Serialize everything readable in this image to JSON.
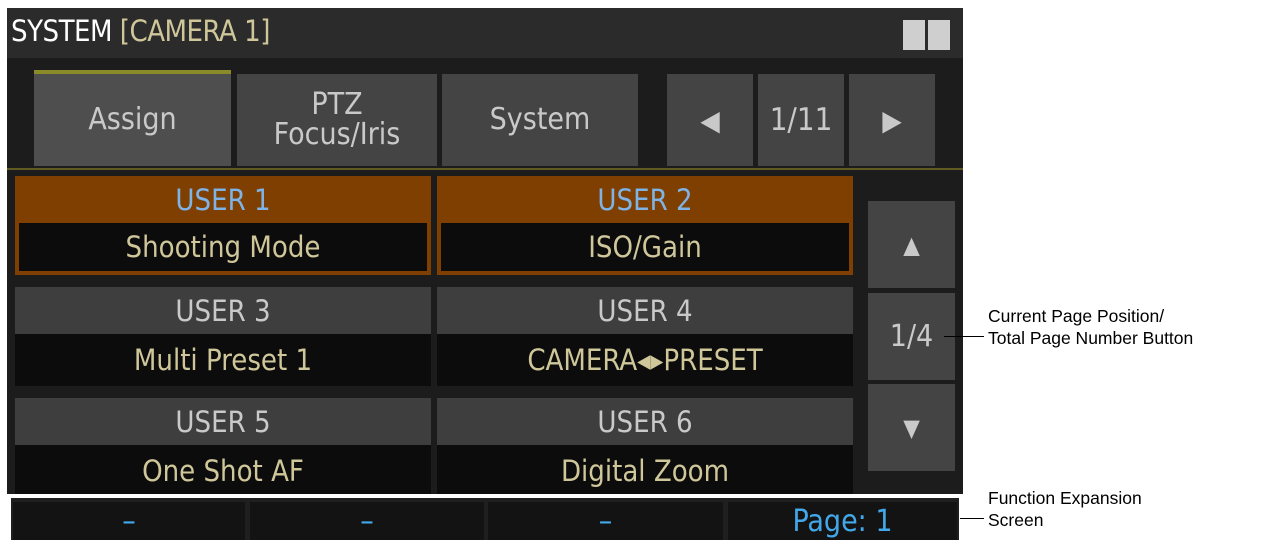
{
  "header": {
    "title_main": "SYSTEM",
    "title_camera": "[CAMERA 1]"
  },
  "tabs": [
    {
      "label": "Assign",
      "active": true
    },
    {
      "label": "PTZ\nFocus/Iris",
      "active": false
    },
    {
      "label": "System",
      "active": false
    }
  ],
  "pager": {
    "prev_icon": "left-triangle-icon",
    "prev_glyph": "◀",
    "label": "1/11",
    "next_icon": "right-triangle-icon",
    "next_glyph": "▶"
  },
  "user_slots": [
    {
      "name": "USER 1",
      "value": "Shooting Mode",
      "selected": true
    },
    {
      "name": "USER 2",
      "value": "ISO/Gain",
      "selected": true
    },
    {
      "name": "USER 3",
      "value": "Multi Preset 1",
      "selected": false
    },
    {
      "name": "USER 4",
      "value": "CAMERA◂▸PRESET",
      "selected": false
    },
    {
      "name": "USER 5",
      "value": "One Shot AF",
      "selected": false
    },
    {
      "name": "USER 6",
      "value": "Digital Zoom",
      "selected": false
    }
  ],
  "scroll": {
    "up_icon": "up-triangle-icon",
    "up_glyph": "▲",
    "page_label": "1/4",
    "down_icon": "down-triangle-icon",
    "down_glyph": "▼"
  },
  "footer": {
    "cells": [
      "–",
      "–",
      "–",
      "Page: 1"
    ]
  },
  "annotations": {
    "page_position_line1": "Current Page Position/",
    "page_position_line2": "Total Page Number Button",
    "function_expansion_line1": "Function Expansion",
    "function_expansion_line2": "Screen"
  },
  "colors": {
    "screen_bg": "#1c1c1c",
    "title_accent": "#cfc79a",
    "selected_slot": "#7e3f00",
    "selected_label": "#7fb2e5",
    "footer_text": "#43a8ea",
    "tab_indicator": "#8a8a2a"
  }
}
